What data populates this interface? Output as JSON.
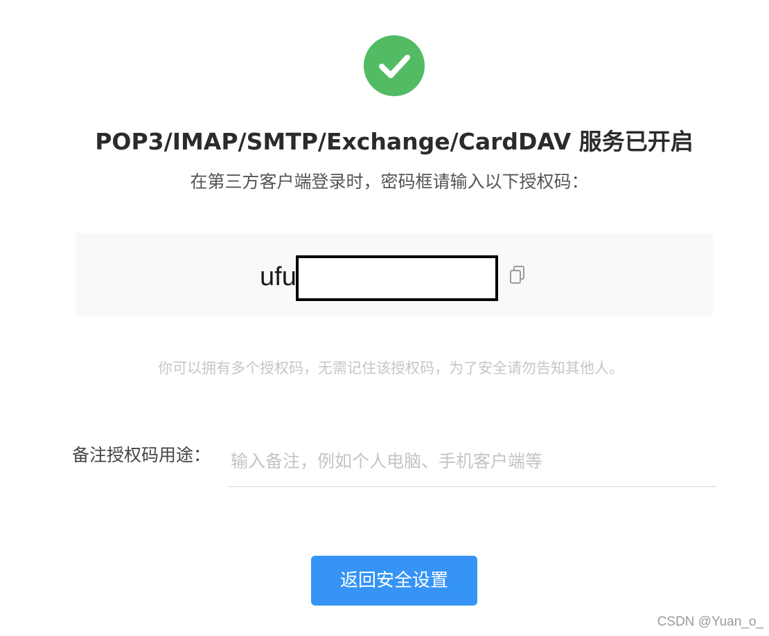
{
  "success_icon": "check-circle-icon",
  "title": "POP3/IMAP/SMTP/Exchange/CardDAV 服务已开启",
  "subtitle": "在第三方客户端登录时，密码框请输入以下授权码：",
  "auth_code": {
    "visible_text": "ufu",
    "copy_icon": "copy-icon"
  },
  "hint": "你可以拥有多个授权码，无需记住该授权码，为了安全请勿告知其他人。",
  "note": {
    "label": "备注授权码用途：",
    "value": "",
    "placeholder": "输入备注，例如个人电脑、手机客户端等"
  },
  "back_button_label": "返回安全设置",
  "watermark": "CSDN @Yuan_o_",
  "colors": {
    "success": "#52bb64",
    "primary_button": "#3594f5",
    "code_background": "#f9f9fa"
  }
}
